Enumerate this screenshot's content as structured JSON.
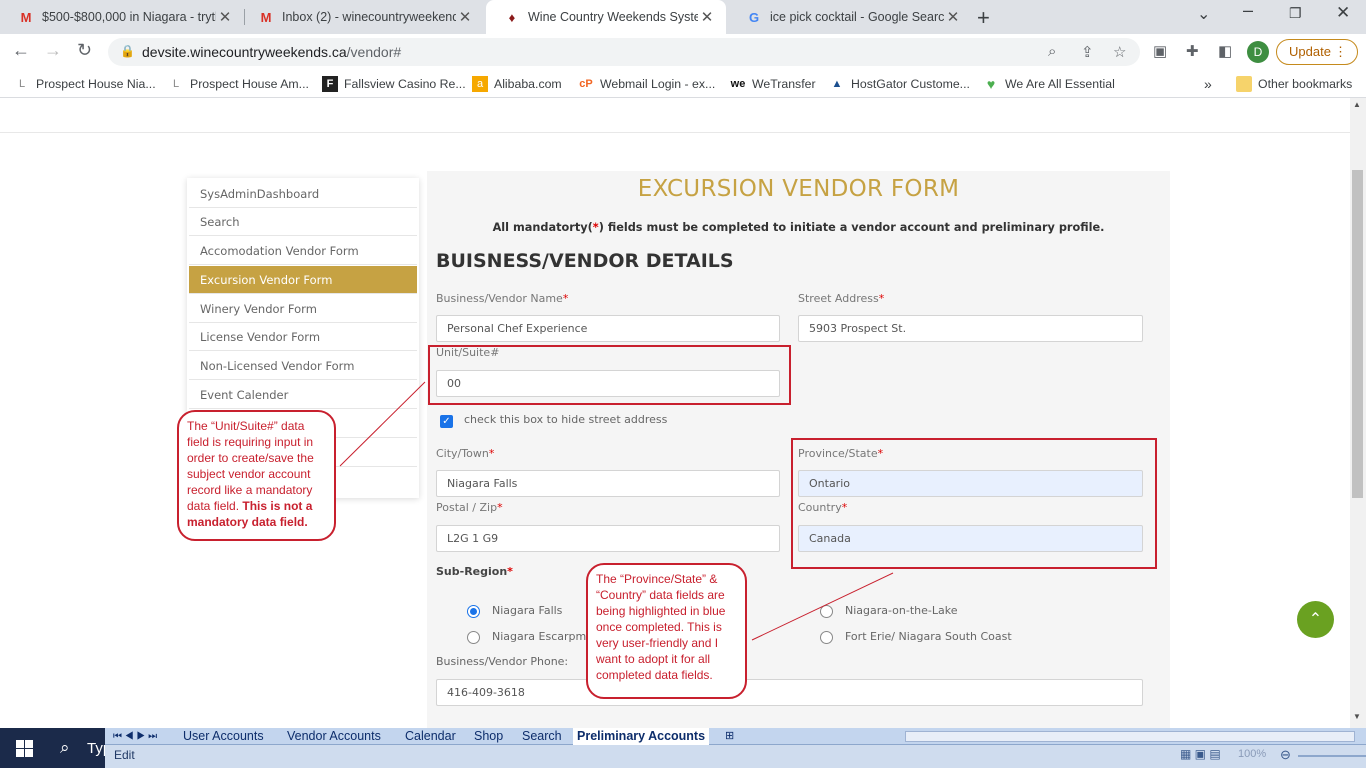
{
  "browser": {
    "tabs": [
      {
        "title": "$500-$800,000 in Niagara - tryth",
        "icon": "gmail-icon"
      },
      {
        "title": "Inbox (2) - winecountryweekends",
        "icon": "gmail-icon"
      },
      {
        "title": "Wine Country Weekends System",
        "icon": "wine-icon"
      },
      {
        "title": "ice pick cocktail - Google Search",
        "icon": "google-icon"
      }
    ],
    "active_tab": 2,
    "url_host": "devsite.winecountryweekends.ca",
    "url_path": "/vendor#",
    "avatar_letter": "D",
    "update_label": "Update",
    "bookmarks": [
      "Prospect House Nia...",
      "Prospect House Am...",
      "Fallsview Casino Re...",
      "Alibaba.com",
      "Webmail Login - ex...",
      "WeTransfer",
      "HostGator Custome...",
      "We Are All Essential"
    ],
    "bookmarks_overflow": "»",
    "other_bookmarks": "Other bookmarks"
  },
  "sidebar": {
    "items": [
      "SysAdminDashboard",
      "Search",
      "Accomodation Vendor Form",
      "Excursion Vendor Form",
      "Winery Vendor Form",
      "License Vendor Form",
      "Non-Licensed Vendor Form",
      "Event Calender"
    ],
    "active_index": 3
  },
  "form": {
    "title": "EXCURSION VENDOR FORM",
    "subtitle_pre": "All mandatorty(",
    "subtitle_star": "*",
    "subtitle_post": ") fields must be completed to initiate a vendor account and preliminary profile.",
    "section_heading": "BUISNESS/VENDOR DETAILS",
    "required_mark": "*",
    "fields": {
      "business_name": {
        "label": "Business/Vendor Name",
        "value": "Personal Chef Experience"
      },
      "street_address": {
        "label": "Street Address",
        "value": "5903 Prospect St."
      },
      "unit_suite": {
        "label": "Unit/Suite#",
        "value": "00"
      },
      "hide_address": {
        "label": "check this box to hide street address",
        "checked": true
      },
      "city": {
        "label": "City/Town",
        "value": "Niagara Falls"
      },
      "province": {
        "label": "Province/State",
        "value": "Ontario"
      },
      "postal": {
        "label": "Postal / Zip",
        "value": "L2G 1 G9"
      },
      "country": {
        "label": "Country",
        "value": "Canada"
      },
      "sub_region": {
        "label": "Sub-Region"
      },
      "phone": {
        "label": "Business/Vendor Phone:",
        "value": "416-409-3618"
      }
    },
    "subregions": [
      {
        "label": "Niagara Falls",
        "selected": true
      },
      {
        "label": "Niagara Escarpme",
        "selected": false
      },
      {
        "label": "Niagara-on-the-Lake",
        "selected": false
      },
      {
        "label": "Fort Erie/ Niagara South Coast",
        "selected": false
      }
    ]
  },
  "annotations": {
    "callout1": {
      "text": "The “Unit/Suite#” data field is requiring input in order to create/save the subject vendor account record like a mandatory data field.",
      "bold": "This is not a mandatory data field."
    },
    "callout2": {
      "text": "The “Province/State” & “Country” data fields are being highlighted in blue once completed.  This is very user-friendly and I want to adopt it for all completed data fields."
    },
    "accent_color": "#c8202e"
  },
  "excel": {
    "sheet_tabs": [
      "User Accounts",
      "Vendor Accounts",
      "Calendar",
      "Shop",
      "Search",
      "Preliminary Accounts"
    ],
    "active_sheet": "Preliminary Accounts",
    "status_mode": "Edit",
    "taskbar_search": "Typ",
    "zoom": "100%"
  },
  "colors": {
    "gold": "#c6a243",
    "scroll_top_button": "#6aa121",
    "filled_field_blue": "#e8f0fe"
  }
}
